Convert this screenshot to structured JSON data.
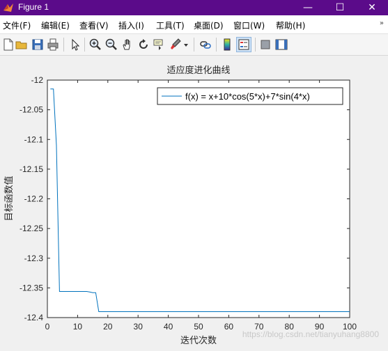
{
  "window": {
    "title": "Figure 1",
    "controls": {
      "minimize": "—",
      "maximize": "☐",
      "close": "✕"
    }
  },
  "menu": [
    "文件(F)",
    "编辑(E)",
    "查看(V)",
    "插入(I)",
    "工具(T)",
    "桌面(D)",
    "窗口(W)",
    "帮助(H)"
  ],
  "menu_overflow_icon": "double-chevron-icon",
  "toolbar": {
    "icons": [
      "new-figure-icon",
      "open-icon",
      "save-icon",
      "print-icon",
      "pointer-icon",
      "zoom-in-icon",
      "zoom-out-icon",
      "pan-icon",
      "rotate-icon",
      "data-cursor-icon",
      "brush-icon",
      "brush-dropdown-icon",
      "link-icon",
      "colorbar-icon",
      "legend-icon",
      "hide-plot-tools-icon",
      "show-plot-tools-icon"
    ],
    "active": "legend-icon"
  },
  "watermark": "https://blog.csdn.net/tianyuhang8800",
  "chart_data": {
    "type": "line",
    "title": "适应度进化曲线",
    "xlabel": "迭代次数",
    "ylabel": "目标函数值",
    "xlim": [
      0,
      100
    ],
    "ylim": [
      -12.4,
      -12.0
    ],
    "xticks": [
      0,
      10,
      20,
      30,
      40,
      50,
      60,
      70,
      80,
      90,
      100
    ],
    "yticks": [
      -12,
      -12.05,
      -12.1,
      -12.15,
      -12.2,
      -12.25,
      -12.3,
      -12.35,
      -12.4
    ],
    "ytick_labels": [
      "-12",
      "-12.05",
      "-12.1",
      "-12.15",
      "-12.2",
      "-12.25",
      "-12.3",
      "-12.35",
      "-12.4"
    ],
    "grid": false,
    "legend_position": "top-right",
    "series": [
      {
        "name": "f(x) = x+10*cos(5*x)+7*sin(4*x)",
        "color": "#0072bd",
        "x": [
          1,
          2,
          3,
          4,
          5,
          13,
          14,
          15,
          16,
          17,
          18,
          100
        ],
        "y": [
          -12.015,
          -12.015,
          -12.11,
          -12.356,
          -12.356,
          -12.356,
          -12.357,
          -12.358,
          -12.358,
          -12.39,
          -12.39,
          -12.39
        ]
      }
    ]
  }
}
